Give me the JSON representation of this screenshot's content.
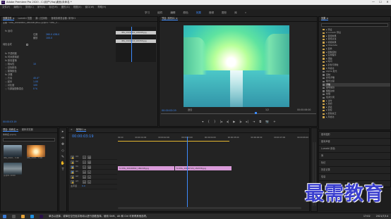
{
  "titlebar": {
    "title": "Adobe Premiere Pro 2020 - C:\\用户\\Ybq\\桌面\\未命名 *",
    "minimize": "—",
    "maximize": "☐",
    "close": "✕"
  },
  "menubar": {
    "items": [
      "文件(F)",
      "编辑(E)",
      "剪辑(C)",
      "序列(S)",
      "标记(M)",
      "图形(G)",
      "视图(V)",
      "窗口(W)",
      "帮助(H)"
    ]
  },
  "workspaces": {
    "tabs": [
      "学习",
      "组件",
      "编辑",
      "颜色",
      "效果",
      "音频",
      "图形",
      "库"
    ],
    "active_index": 4,
    "more": "»"
  },
  "effect_controls": {
    "tabs": [
      "效果控件 ≡",
      "Lumetri 范围",
      "源: (无剪辑)",
      "音频剪辑混合器: 序列01"
    ],
    "clip_path": "主要 * IMG_20190802_180248.JPG ▸ 序列01 * IMG_2...",
    "clips_top": "IMG_20190802_180248.jpg",
    "clips_bottom": "IMG_20190720_181558.jpg",
    "section_motion": "fx 运动",
    "position_label": "位置",
    "position_value": "260.0   438.0",
    "scale_label": "缩放",
    "scale_value": "100.0",
    "rows": [
      {
        "label": "fx 不透明度",
        "value": ""
      },
      {
        "label": "fx 时间重映射",
        "value": ""
      },
      {
        "label": "fx 颜色替换",
        "value": ""
      },
      {
        "label": "◌ 相似性",
        "value": "10"
      },
      {
        "label": "◌ 目标颜色",
        "value": ""
      },
      {
        "label": "◌ 替换颜色",
        "value": ""
      },
      {
        "label": "fx 浮雕",
        "value": ""
      },
      {
        "label": "◌ 方向",
        "value": "45.0°"
      },
      {
        "label": "◌ 起伏",
        "value": "1.00"
      },
      {
        "label": "◌ 对比度",
        "value": "100"
      },
      {
        "label": "◌ 与原始图像混合",
        "value": "0 %"
      }
    ],
    "checkbox_label": "纯色合成",
    "timecode": "00:00:03:19"
  },
  "program_monitor": {
    "tab": "节目: 序列01 ≡",
    "timecode_left": "00:00:03:19",
    "fit": "适合",
    "scale": "1/2",
    "timecode_right": "00:00:06:00",
    "controls": [
      "▾",
      "{",
      "}",
      "|◂",
      "◂|",
      "▶",
      "|▸",
      "▸|",
      "⇥",
      "⧉",
      "📷",
      "+"
    ]
  },
  "project_panel": {
    "tabs": [
      "效果 ≡"
    ],
    "search_placeholder": "",
    "items": [
      {
        "label": "▸ 预设",
        "selected": false
      },
      {
        "label": "▸ Lumetri 预设",
        "selected": false
      },
      {
        "label": "▸ 音频效果",
        "selected": false
      },
      {
        "label": "▸ 音频过渡",
        "selected": false
      },
      {
        "label": "▾ 视频效果",
        "selected": false
      },
      {
        "label": "  ▸ Obsolete",
        "selected": false
      },
      {
        "label": "  ▸ 变换",
        "selected": false
      },
      {
        "label": "  ▸ 图像控制",
        "selected": false
      },
      {
        "label": "  ▸ 实用程序",
        "selected": false
      },
      {
        "label": "  ▸ 扭曲",
        "selected": false
      },
      {
        "label": "  ▸ 时间",
        "selected": false
      },
      {
        "label": "  ▸ 杂色与颗粒",
        "selected": false
      },
      {
        "label": "  ▾ 风格化",
        "selected": false
      },
      {
        "label": "     Alpha 发光",
        "selected": false
      },
      {
        "label": "     复制",
        "selected": false
      },
      {
        "label": "     彩色浮雕",
        "selected": false
      },
      {
        "label": "     曝光过度",
        "selected": false
      },
      {
        "label": "     浮雕",
        "selected": true
      },
      {
        "label": "     画笔描边",
        "selected": false
      },
      {
        "label": "     粗糙边缘",
        "selected": false
      },
      {
        "label": "     纹理",
        "selected": false
      },
      {
        "label": "     色调分离",
        "selected": false
      },
      {
        "label": "  ▸ 过时",
        "selected": false
      },
      {
        "label": "  ▸ 透视",
        "selected": false
      },
      {
        "label": "  ▸ 通道",
        "selected": false
      },
      {
        "label": "  ▸ 键控",
        "selected": false
      },
      {
        "label": "  ▸ 颜色校正",
        "selected": false
      },
      {
        "label": "  ▸ 风格化",
        "selected": false
      }
    ]
  },
  "right_sidebar": {
    "items": [
      "基本图形",
      "基本声音",
      "Lumetri 颜色",
      "库",
      "标记",
      "历史记录",
      "信息"
    ]
  },
  "project_bin": {
    "tabs": [
      "项目: 未命名 ≡",
      "媒体浏览器"
    ],
    "path": "未命名.prproj",
    "thumbs": [
      {
        "name": "IMG_2019... 5:00"
      },
      {
        "name": "IMG_2019... 5:00"
      },
      {
        "name": "序列01 10:00"
      }
    ]
  },
  "tools": [
    "▸",
    "⇹",
    "✥",
    "◇",
    "✎",
    "✋",
    "T"
  ],
  "timeline": {
    "tab": "序列01 ≡",
    "timecode": "00:00:03:19",
    "ruler": [
      "00:00",
      "00:00:01:00",
      "00:00:02:00",
      "00:00:03:00",
      "00:00:04:00",
      "00:00:05:00",
      "00:00:06:00",
      "00:00:07:00",
      "00:00:08:00"
    ],
    "tracks": [
      {
        "name": "V3",
        "lock": "🔒",
        "sync": "▭",
        "eye": "👁"
      },
      {
        "name": "V2",
        "lock": "🔒",
        "sync": "▭",
        "eye": "👁"
      },
      {
        "name": "V1",
        "lock": "🔒",
        "sync": "▭",
        "eye": "👁"
      },
      {
        "name": "A1",
        "lock": "🔒",
        "sync": "M",
        "eye": "S"
      },
      {
        "name": "A2",
        "lock": "🔒",
        "sync": "M",
        "eye": "S"
      },
      {
        "name": "A3",
        "lock": "🔒",
        "sync": "M",
        "eye": "S"
      },
      {
        "name": "主声道",
        "lock": "",
        "sync": "0.0",
        "eye": ""
      }
    ],
    "clip1": "fx IMG_20190802_180248.jpg",
    "clip2": "fx IMG_20190720_181558.jpg"
  },
  "statusbar": {
    "hint": "单击以选择，或单击空白处并拖动以进行选框选择。使用 Shift、Alt 和 Ctrl 可获得其他选项。",
    "time": "17:02",
    "date": "2021/7/14"
  },
  "logo": {
    "text": "最需教育"
  },
  "colors": {
    "accent": "#3d8bfd",
    "clip": "#d99bd9",
    "logo": "#3b3fcf"
  }
}
